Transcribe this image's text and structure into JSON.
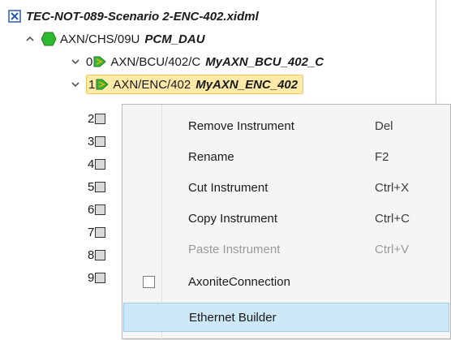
{
  "tree": {
    "root": {
      "label": "TEC-NOT-089-Scenario 2-ENC-402.xidml"
    },
    "chassis": {
      "name": "AXN/CHS/09U",
      "alias": "PCM_DAU"
    },
    "modules": [
      {
        "index": "0",
        "name": "AXN/BCU/402/C",
        "alias": "MyAXN_BCU_402_C"
      },
      {
        "index": "1",
        "name": "AXN/ENC/402",
        "alias": "MyAXN_ENC_402",
        "selected": true
      }
    ],
    "slots": [
      "2",
      "3",
      "4",
      "5",
      "6",
      "7",
      "8",
      "9"
    ]
  },
  "context_menu": {
    "items": [
      {
        "label": "Remove Instrument",
        "shortcut": "Del",
        "enabled": true
      },
      {
        "label": "Rename",
        "shortcut": "F2",
        "enabled": true
      },
      {
        "label": "Cut Instrument",
        "shortcut": "Ctrl+X",
        "enabled": true
      },
      {
        "label": "Copy Instrument",
        "shortcut": "Ctrl+C",
        "enabled": true
      },
      {
        "label": "Paste Instrument",
        "shortcut": "Ctrl+V",
        "enabled": false
      },
      {
        "label": "AxoniteConnection",
        "shortcut": "",
        "enabled": true,
        "checkbox": true,
        "checked": false
      },
      {
        "label": "Ethernet Builder",
        "shortcut": "",
        "enabled": true,
        "highlighted": true
      }
    ]
  },
  "colors": {
    "selection_bg": "#fde9a8",
    "menu_highlight": "#cde8f7",
    "chassis_icon": "#2eb82e",
    "module_icon": "#3cb43c"
  },
  "icons": {
    "root": "xidml-file-icon",
    "chassis": "green-hexagon-chassis-icon",
    "module": "green-module-icon",
    "slot": "empty-slot-icon"
  }
}
